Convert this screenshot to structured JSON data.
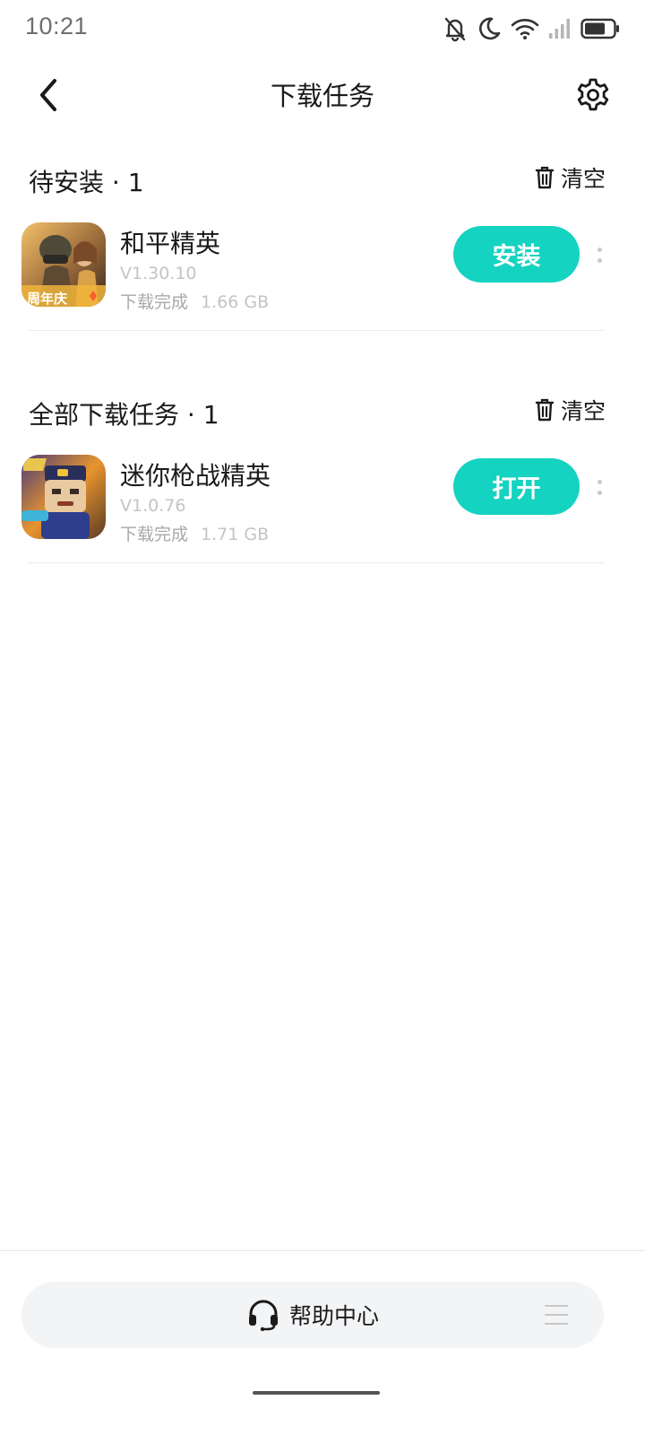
{
  "status_bar": {
    "time": "10:21",
    "icons": [
      "bell-off-icon",
      "moon-icon",
      "wifi-icon",
      "signal-icon",
      "battery-icon"
    ]
  },
  "header": {
    "title": "下载任务",
    "back_icon": "chevron-left-icon",
    "settings_icon": "gear-icon"
  },
  "sections": {
    "pending": {
      "title": "待安装 · 1",
      "clear_label": "清空",
      "items": [
        {
          "name": "和平精英",
          "version": "V1.30.10",
          "status": "下载完成",
          "size": "1.66 GB",
          "action_label": "安装",
          "icon_caption": "周年庆"
        }
      ]
    },
    "all": {
      "title": "全部下载任务 · 1",
      "clear_label": "清空",
      "items": [
        {
          "name": "迷你枪战精英",
          "version": "V1.0.76",
          "status": "下载完成",
          "size": "1.71 GB",
          "action_label": "打开"
        }
      ]
    }
  },
  "bottom_bar": {
    "help_label": "帮助中心",
    "help_icon": "headset-icon",
    "menu_icon": "menu-icon"
  },
  "colors": {
    "accent": "#14d3c0",
    "text_primary": "#1a1a1a",
    "text_secondary": "#a8a8a8",
    "help_bg": "#f3f4f6"
  }
}
